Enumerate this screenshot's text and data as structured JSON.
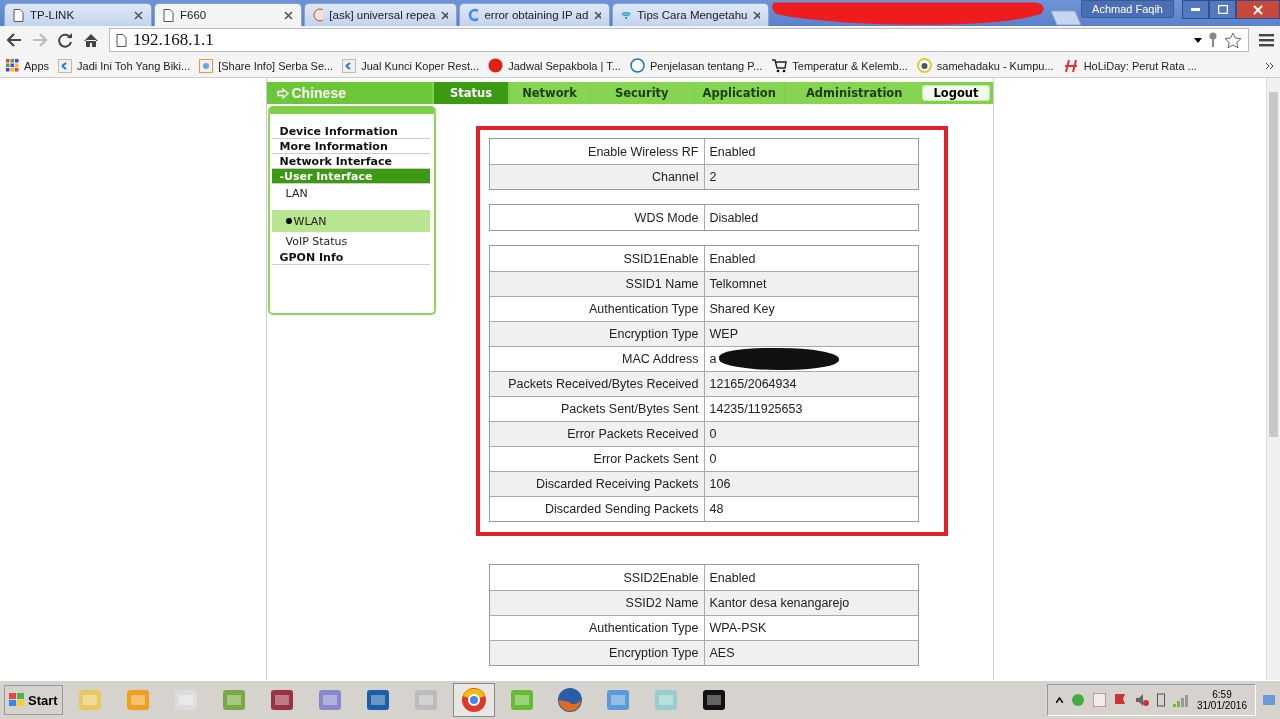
{
  "browser": {
    "tabs": [
      {
        "title": "TP-LINK",
        "selected": false
      },
      {
        "title": "F660",
        "selected": true
      },
      {
        "title": "[ask] universal repea",
        "selected": false
      },
      {
        "title": "error obtaining IP ad",
        "selected": false
      },
      {
        "title": "Tips Cara Mengetahu",
        "selected": false
      }
    ],
    "profile": "Achmad Faqih",
    "address": "192.168.1.1",
    "bookmarks": [
      "Apps",
      "Jadi Ini Toh Yang Biki...",
      "[Share Info] Serba Se...",
      "Jual Kunci Koper Rest...",
      "Jadwal Sepakbola | T...",
      "Penjelasan tentang P...",
      "Temperatur & Kelemb...",
      "samehadaku - Kumpu...",
      "HoLiDay: Perut Rata ..."
    ]
  },
  "router": {
    "language": "Chinese",
    "nav": [
      {
        "label": "Status",
        "selected": true
      },
      {
        "label": "Network",
        "selected": false
      },
      {
        "label": "Security",
        "selected": false
      },
      {
        "label": "Application",
        "selected": false
      },
      {
        "label": "Administration",
        "selected": false
      }
    ],
    "logout": "Logout",
    "sidebar": [
      {
        "label": "Device Information",
        "selected": false
      },
      {
        "label": "More Information",
        "selected": false
      },
      {
        "label": "Network Interface",
        "selected": false
      },
      {
        "label": "-User Interface",
        "selected": true,
        "children": [
          {
            "label": "LAN",
            "selected": false
          },
          {
            "label": "WLAN",
            "selected": true
          },
          {
            "label": "VoIP Status",
            "selected": false
          }
        ]
      },
      {
        "label": "GPON Info",
        "selected": false
      }
    ],
    "sections": [
      {
        "highlighted": true,
        "tables": [
          [
            {
              "label": "Enable Wireless RF",
              "value": "Enabled"
            },
            {
              "label": "Channel",
              "value": "2"
            }
          ],
          [
            {
              "label": "WDS Mode",
              "value": "Disabled"
            }
          ],
          [
            {
              "label": "SSID1Enable",
              "value": "Enabled"
            },
            {
              "label": "SSID1 Name",
              "value": "Telkomnet"
            },
            {
              "label": "Authentication Type",
              "value": "Shared Key"
            },
            {
              "label": "Encryption Type",
              "value": "WEP"
            },
            {
              "label": "MAC Address",
              "value": "a",
              "redacted": true
            },
            {
              "label": "Packets Received/Bytes Received",
              "value": "12165/2064934"
            },
            {
              "label": "Packets Sent/Bytes Sent",
              "value": "14235/11925653"
            },
            {
              "label": "Error Packets Received",
              "value": "0"
            },
            {
              "label": "Error Packets Sent",
              "value": "0"
            },
            {
              "label": "Discarded Receiving Packets",
              "value": "106"
            },
            {
              "label": "Discarded Sending Packets",
              "value": "48"
            }
          ]
        ]
      },
      {
        "highlighted": false,
        "tables": [
          [
            {
              "label": "SSID2Enable",
              "value": "Enabled"
            },
            {
              "label": "SSID2 Name",
              "value": "Kantor desa kenangarejo"
            },
            {
              "label": "Authentication Type",
              "value": "WPA-PSK"
            },
            {
              "label": "Encryption Type",
              "value": "AES"
            }
          ]
        ]
      }
    ]
  },
  "taskbar": {
    "start": "Start",
    "time": "6:59",
    "date": "31/01/2016"
  }
}
